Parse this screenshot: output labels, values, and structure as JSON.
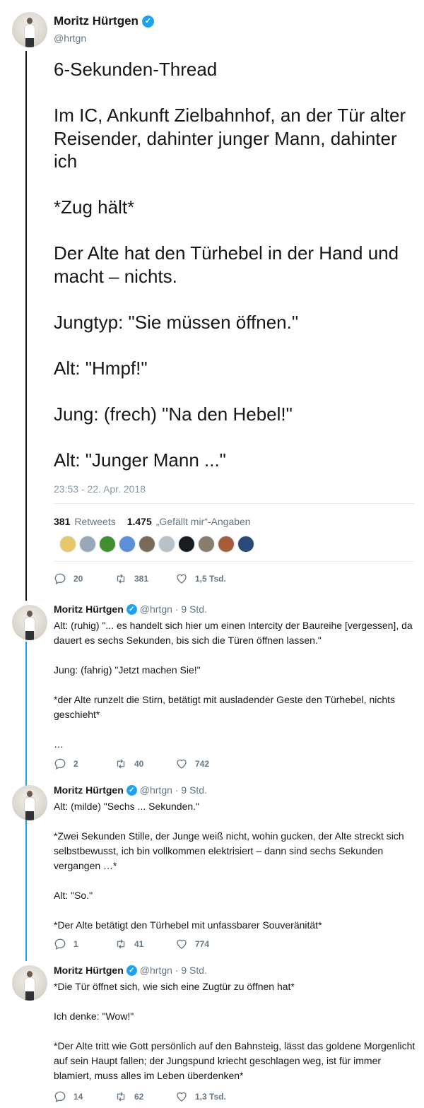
{
  "colors": {
    "accent": "#1da1f2",
    "secondary_text": "#657786",
    "thread_line_main": "#141619"
  },
  "author": {
    "name": "Moritz Hürtgen",
    "handle": "@hrtgn"
  },
  "main_tweet": {
    "text": "6-Sekunden-Thread\n\nIm IC, Ankunft Zielbahnhof, an der Tür alter Reisender, dahinter junger Mann, dahinter ich\n\n*Zug hält*\n\nDer Alte hat den Türhebel in der Hand und macht – nichts.\n\nJungtyp: \"Sie müssen öffnen.\"\n\nAlt: \"Hmpf!\"\n\nJung: (frech) \"Na den Hebel!\"\n\nAlt: \"Junger Mann ...\"",
    "timestamp": "23:53 - 22. Apr. 2018",
    "retweet_count": "381",
    "retweet_label": "Retweets",
    "like_count": "1.475",
    "like_label": "„Gefällt mir“-Angaben",
    "likers": [
      "#e8c76a",
      "#9aa7b8",
      "#3f8f2f",
      "#5b8fd6",
      "#7a6a58",
      "#b8c0c8",
      "#1a1c1f",
      "#8a7d6e",
      "#a45c3a",
      "#2c4a78"
    ],
    "actions": {
      "replies": "20",
      "retweets": "381",
      "likes": "1,5 Tsd."
    }
  },
  "replies": [
    {
      "meta": "@hrtgn · 9 Std.",
      "text": "Alt: (ruhig) \"... es handelt sich hier um einen Intercity der Baureihe [vergessen], da dauert es sechs Sekunden, bis sich die Türen öffnen lassen.\"\n\nJung: (fahrig) \"Jetzt machen Sie!\"\n\n*der Alte runzelt die Stirn, betätigt mit ausladender Geste den Türhebel, nichts geschieht*\n\n…",
      "actions": {
        "replies": "2",
        "retweets": "40",
        "likes": "742"
      }
    },
    {
      "meta": "@hrtgn · 9 Std.",
      "text": "Alt: (milde) \"Sechs ... Sekunden.\"\n\n*Zwei Sekunden Stille, der Junge weiß nicht, wohin gucken, der Alte streckt sich selbstbewusst, ich bin vollkommen elektrisiert – dann sind sechs Sekunden vergangen …*\n\nAlt: \"So.\"\n\n*Der Alte betätigt den Türhebel mit unfassbarer Souveränität*",
      "actions": {
        "replies": "1",
        "retweets": "41",
        "likes": "774"
      }
    },
    {
      "meta": "@hrtgn · 9 Std.",
      "text": "*Die Tür öffnet sich, wie sich eine Zugtür zu öffnen hat*\n\nIch denke: \"Wow!\"\n\n*Der Alte tritt wie Gott persönlich auf den Bahnsteig, lässt das goldene Morgenlicht auf sein Haupt fallen; der Jungspund kriecht geschlagen weg, ist für immer blamiert, muss alles im Leben überdenken*",
      "actions": {
        "replies": "14",
        "retweets": "62",
        "likes": "1,3 Tsd."
      }
    }
  ]
}
